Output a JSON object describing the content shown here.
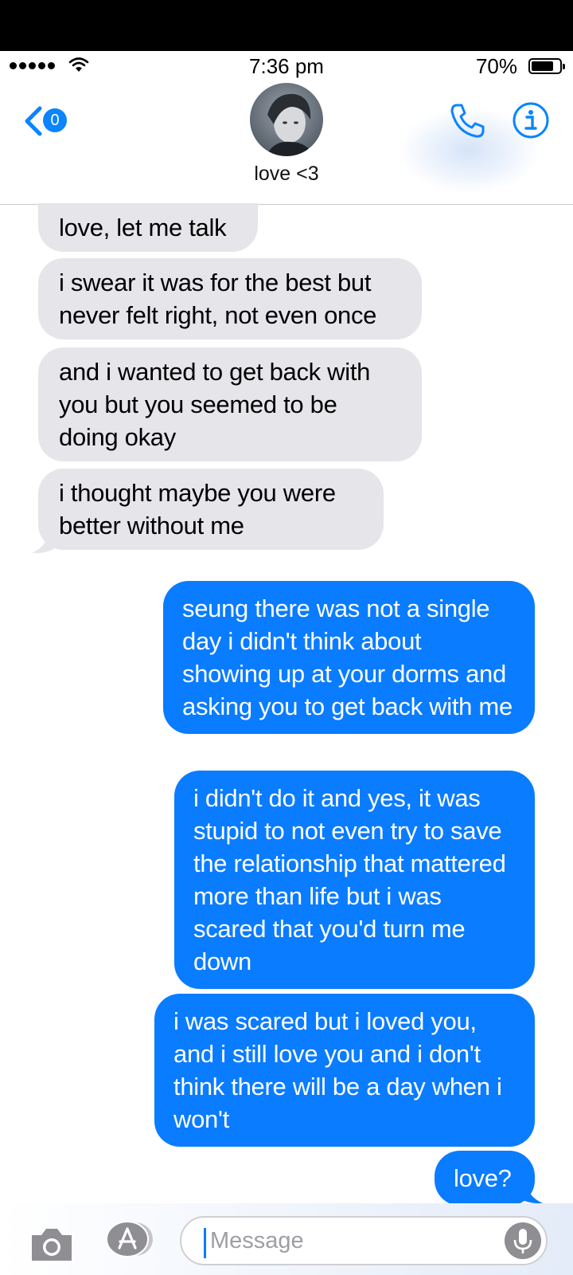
{
  "status": {
    "time": "7:36 pm",
    "battery": "70%"
  },
  "header": {
    "back_badge": "0",
    "contact_name": "love <3"
  },
  "messages": [
    {
      "from": "them",
      "text": "love, let me talk"
    },
    {
      "from": "them",
      "text": "i swear it was for the best but never felt right, not even once"
    },
    {
      "from": "them",
      "text": "and i wanted to get back with you but you seemed to be doing okay"
    },
    {
      "from": "them",
      "text": "i thought maybe you were better without me"
    },
    {
      "from": "me",
      "text": "seung there was not a single day i didn't think about showing up at your dorms and asking you to get back with me"
    },
    {
      "from": "me",
      "text": "i didn't do it and yes, it was stupid to not even try to save the relationship that mattered more than life but i was scared that you'd turn me down"
    },
    {
      "from": "me",
      "text": "i was scared but i loved you, and i still love you and i don't think there will be a day when i won't"
    },
    {
      "from": "me",
      "text": "love?"
    }
  ],
  "input": {
    "placeholder": "Message"
  },
  "colors": {
    "sent_bubble": "#0a7cff",
    "received_bubble": "#e5e5ea",
    "accent": "#0a84ff"
  }
}
